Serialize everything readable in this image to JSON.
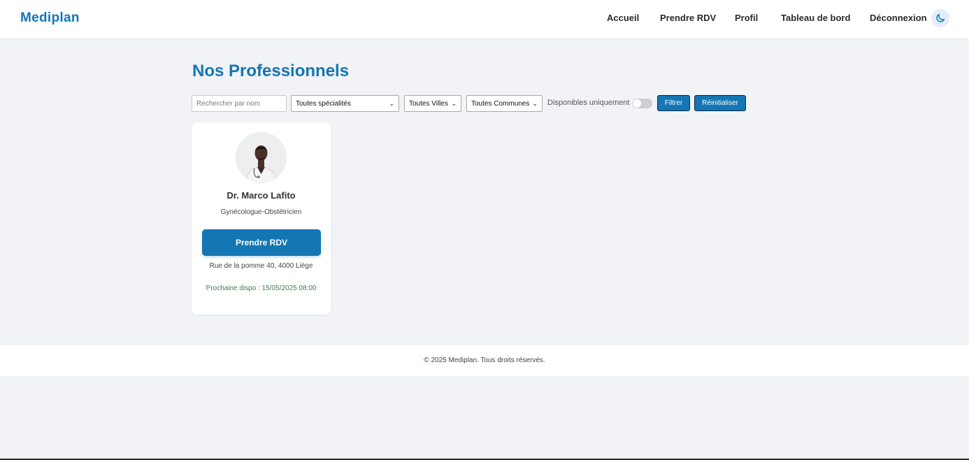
{
  "header": {
    "brand": "Mediplan",
    "nav": [
      {
        "label": "Accueil"
      },
      {
        "label": "Prendre RDV"
      },
      {
        "label": "Profil"
      },
      {
        "label": "Tableau de bord"
      },
      {
        "label": "Déconnexion"
      }
    ],
    "theme_icon": "moon-icon"
  },
  "main": {
    "title": "Nos Professionnels",
    "filters": {
      "search_placeholder": "Rechercher par nom",
      "search_value": "",
      "specialty_selected": "Toutes spécialités",
      "city_selected": "Toutes Villes",
      "commune_selected": "Toutes Communes",
      "available_label": "Disponibles uniquement",
      "available_on": false,
      "filter_button": "Filtrer",
      "reset_button": "Réinitialiser"
    },
    "professionals": [
      {
        "name": "Dr. Marco Lafito",
        "specialty": "Gynécologue-Obstétricien",
        "cta": "Prendre RDV",
        "address": "Rue de la pomme 40, 4000 Liège",
        "next_available": "Prochaine dispo : 15/05/2025 08:00"
      }
    ]
  },
  "footer": {
    "text": "© 2025 Mediplan. Tous droits réservés."
  },
  "colors": {
    "brand": "#1476b3",
    "background": "#f1f3f6",
    "availability": "#3f7a50"
  }
}
